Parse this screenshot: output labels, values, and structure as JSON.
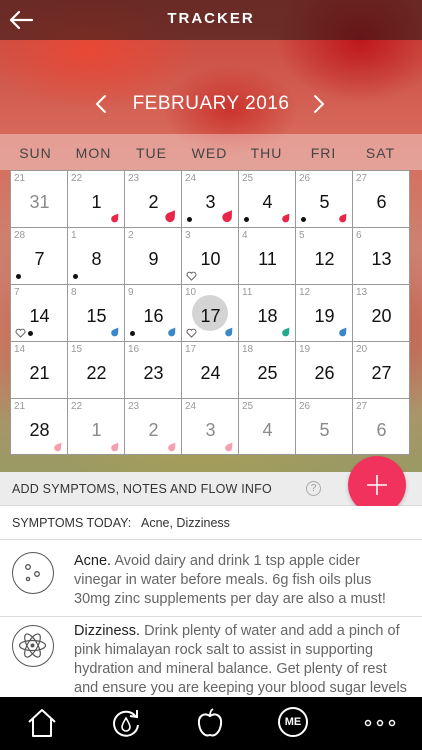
{
  "header": {
    "title": "TRACKER",
    "back_icon": "back-arrow-icon"
  },
  "calendar": {
    "month_label": "FEBRUARY 2016",
    "weekdays": [
      "SUN",
      "MON",
      "TUE",
      "WED",
      "THU",
      "FRI",
      "SAT"
    ],
    "colors": {
      "flow": "#e8264a",
      "light_flow": "#f4a0b0",
      "blue": "#3c87c8",
      "green": "#20a88a",
      "today": "#d4d4d4"
    },
    "weeks": [
      [
        {
          "small": "21",
          "big": "31",
          "faded": true
        },
        {
          "small": "22",
          "big": "1",
          "drop": "flow-small"
        },
        {
          "small": "23",
          "big": "2",
          "drop": "flow-large"
        },
        {
          "small": "24",
          "big": "3",
          "drop": "flow-large",
          "dot": true
        },
        {
          "small": "25",
          "big": "4",
          "drop": "flow-small",
          "dot": true
        },
        {
          "small": "26",
          "big": "5",
          "drop": "flow-small",
          "dot": true
        },
        {
          "small": "27",
          "big": "6"
        }
      ],
      [
        {
          "small": "28",
          "big": "7",
          "dot": true
        },
        {
          "small": "1",
          "big": "8",
          "dot": true
        },
        {
          "small": "2",
          "big": "9"
        },
        {
          "small": "3",
          "big": "10",
          "heart": true
        },
        {
          "small": "4",
          "big": "11"
        },
        {
          "small": "5",
          "big": "12"
        },
        {
          "small": "6",
          "big": "13"
        }
      ],
      [
        {
          "small": "7",
          "big": "14",
          "heart": true,
          "dot": true
        },
        {
          "small": "8",
          "big": "15",
          "drop": "blue"
        },
        {
          "small": "9",
          "big": "16",
          "drop": "blue",
          "dot": true
        },
        {
          "small": "10",
          "big": "17",
          "today": true,
          "heart": true,
          "drop": "blue"
        },
        {
          "small": "11",
          "big": "18",
          "drop": "green"
        },
        {
          "small": "12",
          "big": "19",
          "drop": "blue"
        },
        {
          "small": "13",
          "big": "20"
        }
      ],
      [
        {
          "small": "14",
          "big": "21"
        },
        {
          "small": "15",
          "big": "22"
        },
        {
          "small": "16",
          "big": "23"
        },
        {
          "small": "17",
          "big": "24"
        },
        {
          "small": "18",
          "big": "25"
        },
        {
          "small": "19",
          "big": "26"
        },
        {
          "small": "20",
          "big": "27"
        }
      ],
      [
        {
          "small": "21",
          "big": "28",
          "drop": "light"
        },
        {
          "small": "22",
          "big": "1",
          "drop": "light",
          "faded": true
        },
        {
          "small": "23",
          "big": "2",
          "drop": "light",
          "faded": true
        },
        {
          "small": "24",
          "big": "3",
          "drop": "light",
          "faded": true
        },
        {
          "small": "25",
          "big": "4",
          "faded": true
        },
        {
          "small": "26",
          "big": "5",
          "faded": true
        },
        {
          "small": "27",
          "big": "6",
          "faded": true
        }
      ]
    ]
  },
  "add_bar": {
    "label": "ADD SYMPTOMS, NOTES AND FLOW INFO",
    "help": "?",
    "fab_color": "#f0325d"
  },
  "symptoms_today": {
    "prefix": "SYMPTOMS TODAY:",
    "list": "Acne, Dizziness"
  },
  "symptoms": [
    {
      "name": "Acne.",
      "text": "Avoid dairy and drink 1 tsp apple cider vinegar in water before meals. 6g fish oils plus 30mg zinc supplements per day are also a must!",
      "icon": "acne-icon"
    },
    {
      "name": "Dizziness.",
      "text": "Drink plenty of water and add a pinch of pink himalayan rock salt to assist in supporting hydration and mineral balance. Get plenty of rest and ensure you are keeping your blood sugar levels stable with regular meals and snacks.",
      "icon": "atom-icon"
    }
  ],
  "bottom_nav": {
    "me_label": "ME",
    "icons": [
      "home-icon",
      "cycle-icon",
      "apple-icon",
      "me-icon",
      "more-icon"
    ]
  }
}
